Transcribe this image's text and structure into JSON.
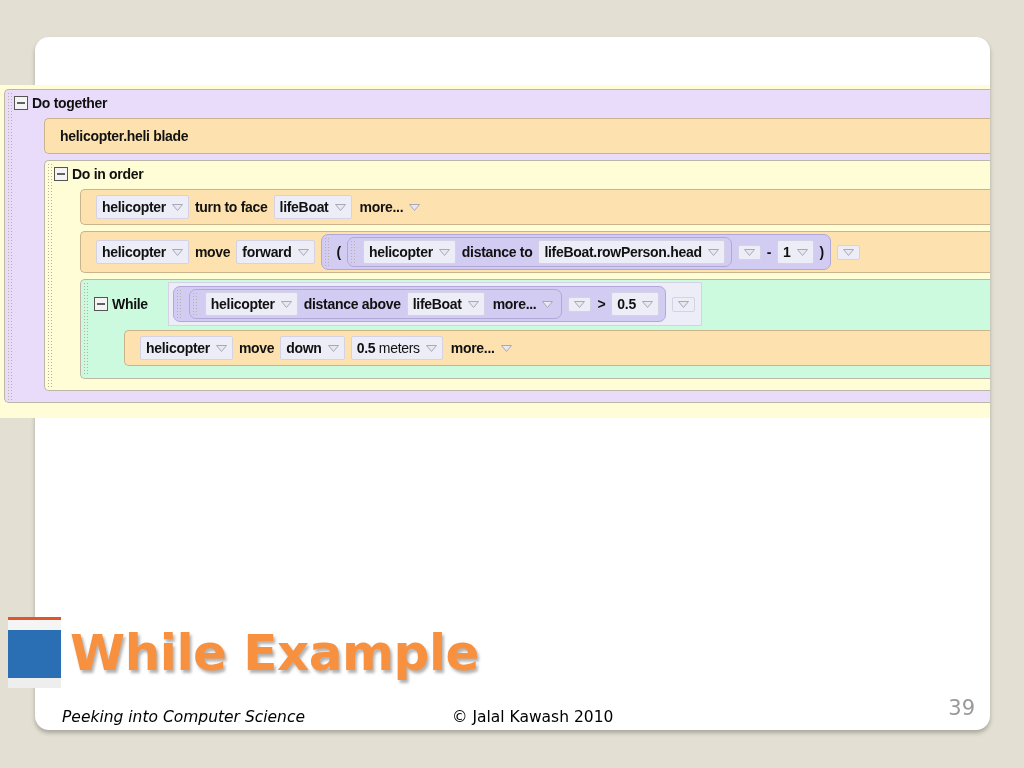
{
  "code": {
    "kind": "do_together",
    "label": "Do together",
    "expanded": true,
    "children": [
      {
        "kind": "statement",
        "tokens": [
          {
            "kind": "word",
            "text": "helicopter.heli blade"
          }
        ]
      },
      {
        "kind": "do_in_order",
        "label": "Do in order",
        "expanded": true,
        "children": [
          {
            "kind": "statement",
            "tokens": [
              {
                "kind": "dropdown",
                "text": "helicopter"
              },
              {
                "kind": "word",
                "text": "turn to face"
              },
              {
                "kind": "dropdown",
                "text": "lifeBoat"
              },
              {
                "kind": "menu",
                "text": "more..."
              }
            ]
          },
          {
            "kind": "statement",
            "tokens": [
              {
                "kind": "dropdown",
                "text": "helicopter"
              },
              {
                "kind": "word",
                "text": "move"
              },
              {
                "kind": "dropdown",
                "text": "forward"
              },
              {
                "kind": "expr",
                "tokens": [
                  {
                    "kind": "word",
                    "text": "("
                  },
                  {
                    "kind": "expr",
                    "tokens": [
                      {
                        "kind": "dropdown",
                        "text": "helicopter"
                      },
                      {
                        "kind": "word",
                        "text": "distance to"
                      },
                      {
                        "kind": "dropdown",
                        "text": "lifeBoat.rowPerson.head"
                      }
                    ]
                  },
                  {
                    "kind": "arrow"
                  },
                  {
                    "kind": "word",
                    "text": "-"
                  },
                  {
                    "kind": "dropdown",
                    "text": "1"
                  },
                  {
                    "kind": "word",
                    "text": ")"
                  }
                ]
              },
              {
                "kind": "arrow"
              }
            ]
          },
          {
            "kind": "while",
            "label": "While",
            "expanded": true,
            "condition": [
              {
                "kind": "expr",
                "tokens": [
                  {
                    "kind": "expr",
                    "tokens": [
                      {
                        "kind": "dropdown",
                        "text": "helicopter"
                      },
                      {
                        "kind": "word",
                        "text": "distance above"
                      },
                      {
                        "kind": "dropdown",
                        "text": "lifeBoat"
                      },
                      {
                        "kind": "menu",
                        "text": "more..."
                      }
                    ]
                  },
                  {
                    "kind": "arrow"
                  },
                  {
                    "kind": "word",
                    "text": ">"
                  },
                  {
                    "kind": "dropdown",
                    "text": "0.5"
                  }
                ]
              },
              {
                "kind": "arrow"
              }
            ],
            "children": [
              {
                "kind": "statement",
                "tokens": [
                  {
                    "kind": "dropdown",
                    "text": "helicopter"
                  },
                  {
                    "kind": "word",
                    "text": "move"
                  },
                  {
                    "kind": "dropdown",
                    "text": "down"
                  },
                  {
                    "kind": "quantity",
                    "text": "**0.5** meters"
                  },
                  {
                    "kind": "menu",
                    "text": "more..."
                  }
                ]
              }
            ]
          }
        ]
      }
    ]
  },
  "slide": {
    "title": "While Example",
    "footer_left": "Peeking into Computer Science",
    "footer_center": "© Jalal Kawash 2010",
    "page_number": "39"
  }
}
